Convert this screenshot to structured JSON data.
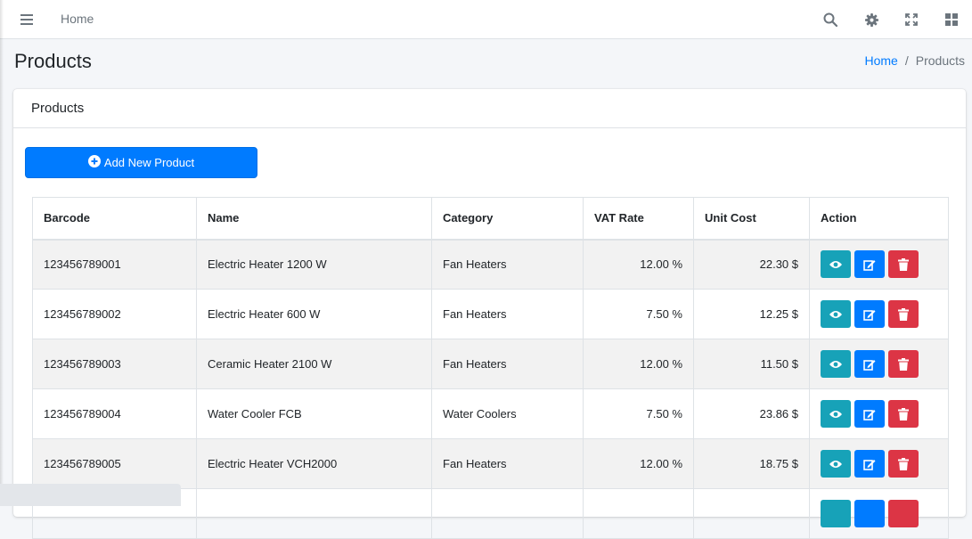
{
  "navbar": {
    "home_label": "Home",
    "icons": [
      "menu-icon",
      "search-icon",
      "gear-icon",
      "expand-icon",
      "grid-icon"
    ]
  },
  "page": {
    "title": "Products",
    "breadcrumb": {
      "home": "Home",
      "separator": "/",
      "current": "Products"
    }
  },
  "card": {
    "title": "Products",
    "add_button_label": "Add New Product"
  },
  "table": {
    "headers": [
      "Barcode",
      "Name",
      "Category",
      "VAT Rate",
      "Unit Cost",
      "Action"
    ],
    "rows": [
      {
        "barcode": "123456789001",
        "name": "Electric Heater 1200 W",
        "category": "Fan Heaters",
        "vat": "12.00 %",
        "cost": "22.30 $"
      },
      {
        "barcode": "123456789002",
        "name": "Electric Heater 600 W",
        "category": "Fan Heaters",
        "vat": "7.50 %",
        "cost": "12.25 $"
      },
      {
        "barcode": "123456789003",
        "name": "Ceramic Heater 2100 W",
        "category": "Fan Heaters",
        "vat": "12.00 %",
        "cost": "11.50 $"
      },
      {
        "barcode": "123456789004",
        "name": "Water Cooler FCB",
        "category": "Water Coolers",
        "vat": "7.50 %",
        "cost": "23.86 $"
      },
      {
        "barcode": "123456789005",
        "name": "Electric Heater VCH2000",
        "category": "Fan Heaters",
        "vat": "12.00 %",
        "cost": "18.75 $"
      },
      {
        "barcode": "",
        "name": "",
        "category": "",
        "vat": "",
        "cost": ""
      }
    ]
  },
  "colors": {
    "primary": "#007bff",
    "info": "#17a2b8",
    "danger": "#dc3545"
  }
}
